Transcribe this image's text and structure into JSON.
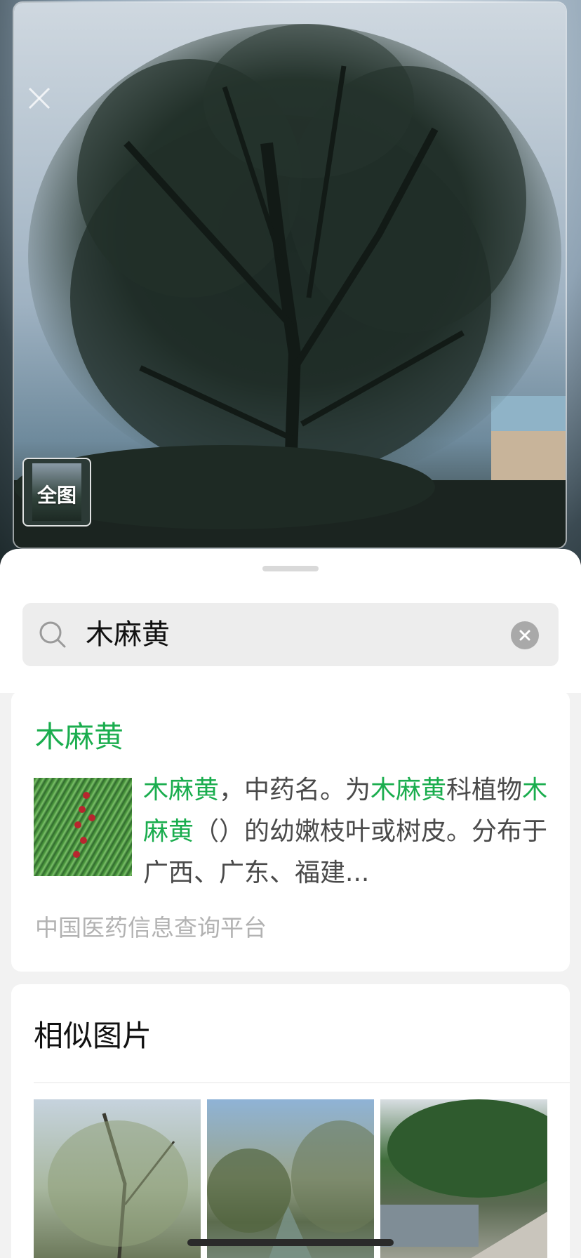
{
  "photo": {
    "thumbnail_label": "全图"
  },
  "sheet": {
    "search": {
      "query": "木麻黄"
    },
    "result": {
      "title": "木麻黄",
      "description_segments": [
        {
          "text": "木麻黄",
          "highlight": true
        },
        {
          "text": "，中药名。为",
          "highlight": false
        },
        {
          "text": "木麻黄",
          "highlight": true
        },
        {
          "text": "科植物",
          "highlight": false
        },
        {
          "text": "木麻黄",
          "highlight": true
        },
        {
          "text": "（）的幼嫩枝叶或树皮。分布于广西、广东、福建...",
          "highlight": false
        }
      ],
      "source": "中国医药信息查询平台"
    },
    "similar": {
      "title": "相似图片",
      "images": [
        "similar-image-1",
        "similar-image-2",
        "similar-image-3"
      ]
    }
  },
  "colors": {
    "highlight": "#1aad4e",
    "source_text": "#b2b2b2",
    "body_text": "#4a4a4a"
  }
}
